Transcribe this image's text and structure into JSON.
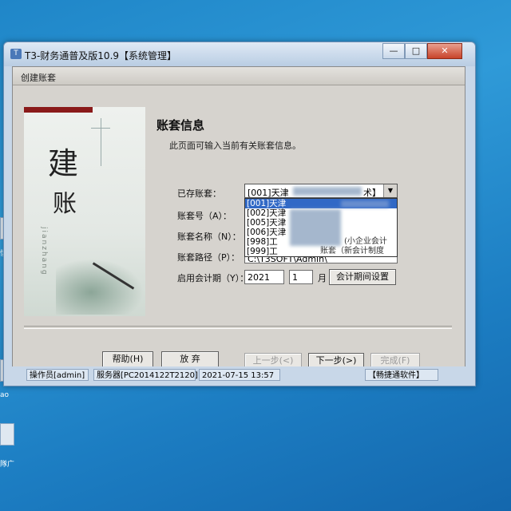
{
  "desktop": {
    "icons": [
      {
        "label": "惧"
      },
      {
        "label": "ao"
      },
      {
        "label": "隊广"
      }
    ]
  },
  "window": {
    "title": "T3-财务通普及版10.9【系统管理】",
    "controls": {
      "minimize": "—",
      "maximize": "□",
      "close": "✕"
    }
  },
  "dialog": {
    "title": "创建账套",
    "side_art": {
      "char1": "建",
      "char2": "账",
      "pinyin": "jianzhang"
    },
    "heading": "账套信息",
    "description": "此页面可输入当前有关账套信息。",
    "labels": {
      "existing": "已存账套：",
      "number": "账套号（A）：",
      "name": "账套名称（N）：",
      "path": "账套路径（P）：",
      "period": "启用会计期（Y）："
    },
    "existing_combo": {
      "value": "[001]天津",
      "tail": "术】"
    },
    "dropdown_items": [
      {
        "code": "[001]天津",
        "suffix": "",
        "selected": true
      },
      {
        "code": "[002]天津",
        "suffix": "",
        "selected": false
      },
      {
        "code": "[005]天津",
        "suffix": "",
        "selected": false
      },
      {
        "code": "[006]天津",
        "suffix": "",
        "selected": false
      },
      {
        "code": "[998]工",
        "suffix": "(小企业会计",
        "selected": false
      },
      {
        "code": "[999]工",
        "suffix": "账套（新会计制度",
        "selected": false
      }
    ],
    "path_value": "C:\\T3SOFT\\Admin\\",
    "year": "2021",
    "month": "1",
    "month_unit": "月",
    "buttons": {
      "period_settings": "会计期间设置",
      "help": "帮助(H)",
      "abort": "放 弃",
      "prev": "上一步(<)",
      "next": "下一步(>)",
      "finish": "完成(F)"
    }
  },
  "statusbar": {
    "operator": "操作员[admin]",
    "server": "服务器[PC2014122T2120]",
    "datetime": "2021-07-15 13:57",
    "brand": "【畅捷通软件】"
  }
}
